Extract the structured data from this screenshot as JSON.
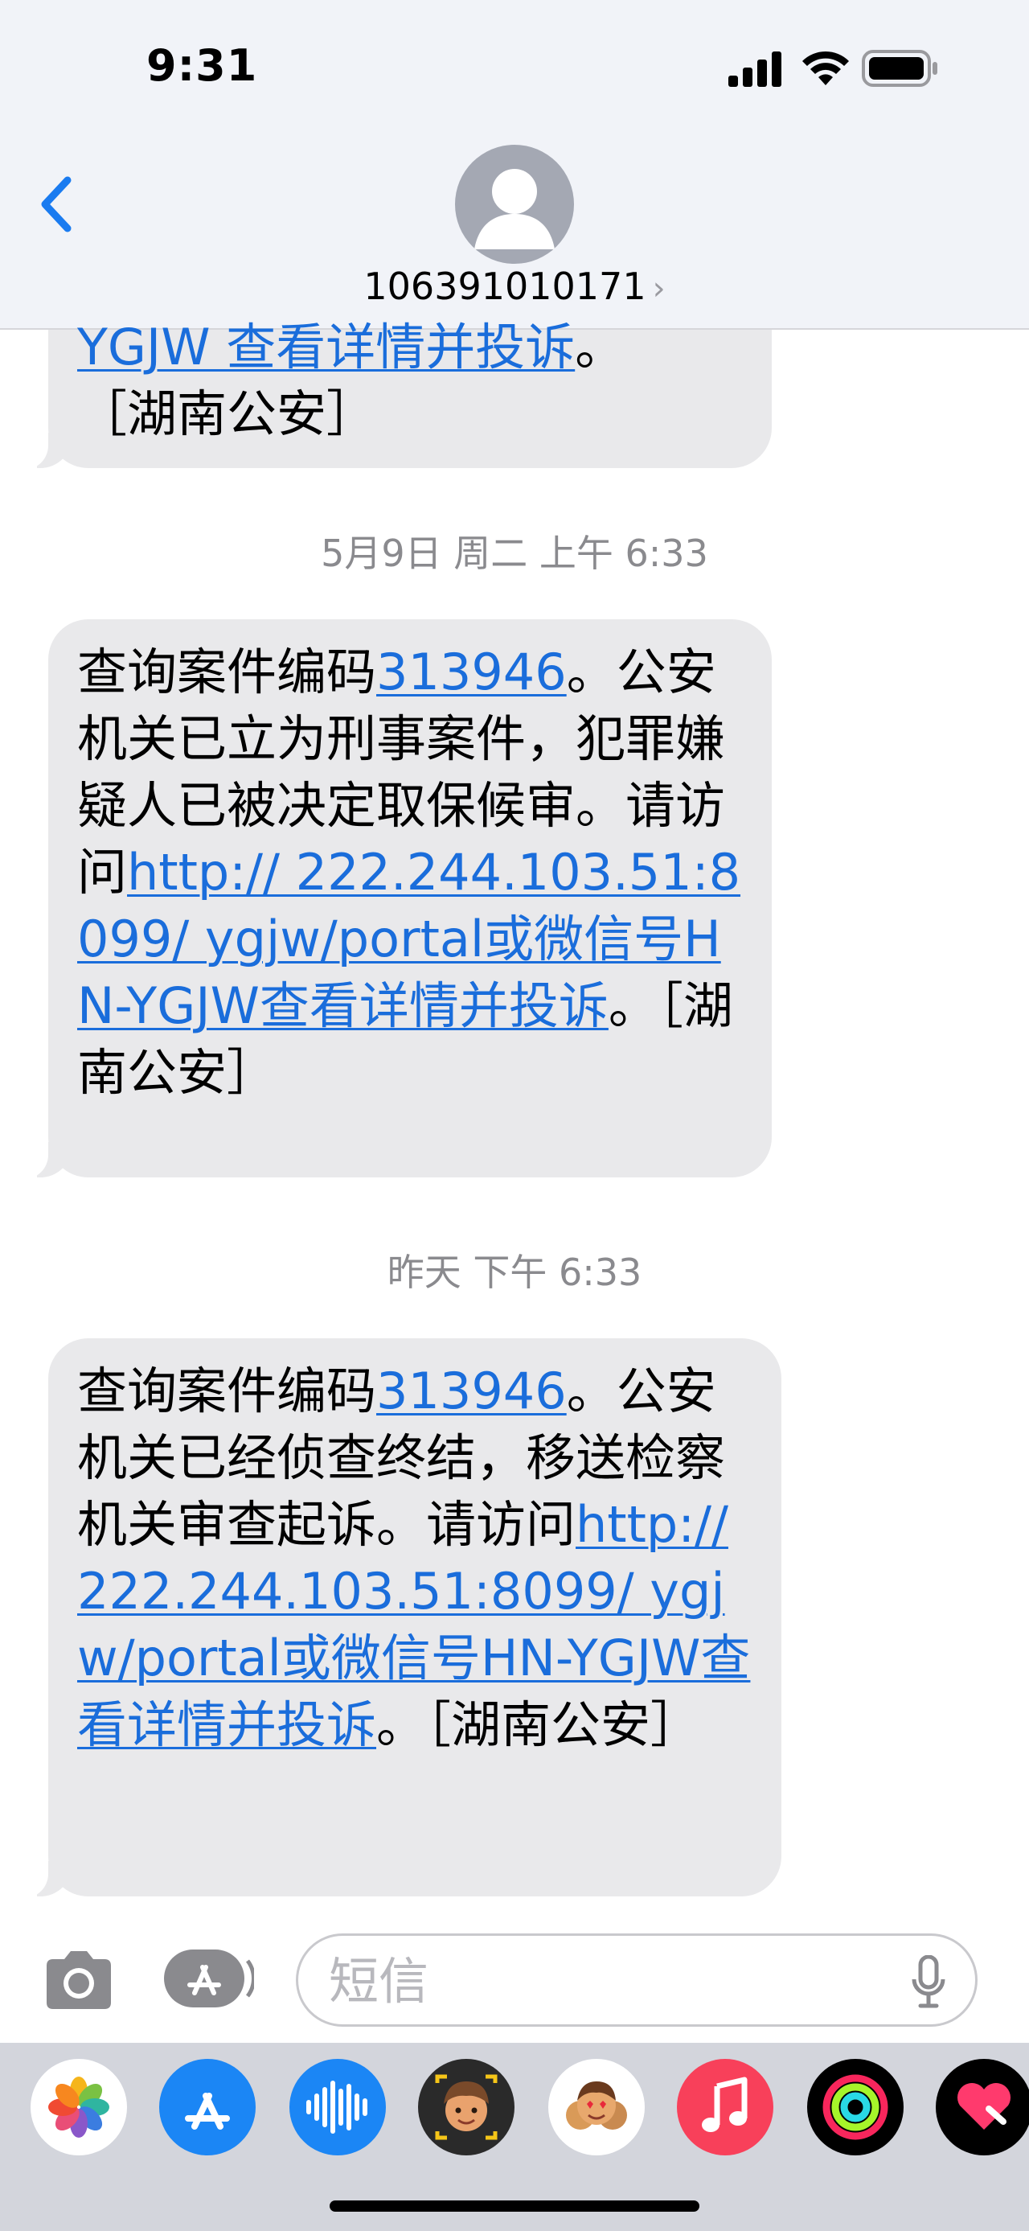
{
  "status_bar": {
    "time": "9:31"
  },
  "header": {
    "contact_name": "106391010171",
    "chevron": "›"
  },
  "messages": [
    {
      "top_line_link": "YGJW 查看详情并投诉",
      "top_line_tail": "。",
      "signature": "［湖南公安］"
    },
    {
      "timestamp": "5月9日 周二 上午 6:33",
      "text_start": "查询案件编码",
      "case_code": "313946",
      "text_middle": "。公安机关已立为刑事案件，犯罪嫌疑人已被决定取保候审。请访问",
      "link": "http:// 222.244.103.51:8099/ ygjw/portal或微信号HN-YGJW查看详情并投诉",
      "text_end": "。［湖南公安］"
    },
    {
      "timestamp": "昨天 下午 6:33",
      "text_start": "查询案件编码",
      "case_code": "313946",
      "text_middle": "。公安机关已经侦查终结，移送检察机关审查起诉。请访问",
      "link": "http:// 222.244.103.51:8099/ ygjw/portal或微信号HN-YGJW查看详情并投诉",
      "text_end": "。［湖南公安］"
    }
  ],
  "input": {
    "placeholder": "短信"
  },
  "app_drawer": {
    "apps": [
      "photos-icon",
      "app-store-icon",
      "audio-message-icon",
      "memoji-icon",
      "memoji-stickers-icon",
      "music-icon",
      "activity-icon",
      "digital-touch-icon"
    ]
  },
  "colors": {
    "link": "#1a6ddb",
    "bubble": "#e9e9eb",
    "timestamp": "#8a8a8e"
  }
}
